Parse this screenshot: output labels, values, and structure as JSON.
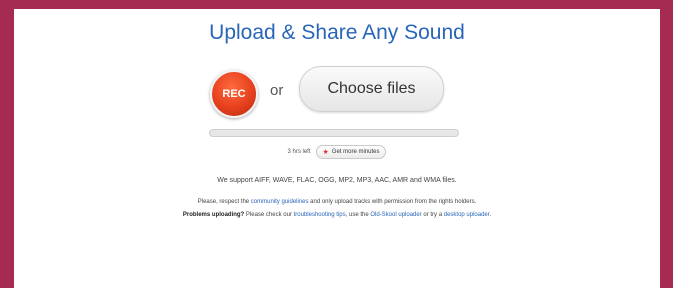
{
  "title": "Upload & Share Any Sound",
  "rec_button": "REC",
  "or_text": "or",
  "choose_files": "Choose files",
  "progress": 0,
  "minutes": {
    "time_left": "3 hrs left",
    "get_more": "Get more minutes"
  },
  "formats_text": "We support AIFF, WAVE, FLAC, OGG, MP2, MP3, AAC, AMR and WMA files.",
  "guidelines": {
    "prefix": "Please, respect the",
    "link": "community guidelines",
    "suffix": "and only upload tracks with permission from the rights holders."
  },
  "problems": {
    "bold": "Problems uploading?",
    "text1": "Please check our",
    "link1": "troubleshooting tips",
    "text2": ", use the",
    "link2": "Old-Skool uploader",
    "text3": "or try a",
    "link3": "desktop uploader",
    "text4": "."
  },
  "colors": {
    "background": "#a52b52",
    "title": "#2966b8",
    "rec": "#e6401e",
    "link": "#2966b8"
  },
  "icons": {
    "star": "star-icon"
  }
}
